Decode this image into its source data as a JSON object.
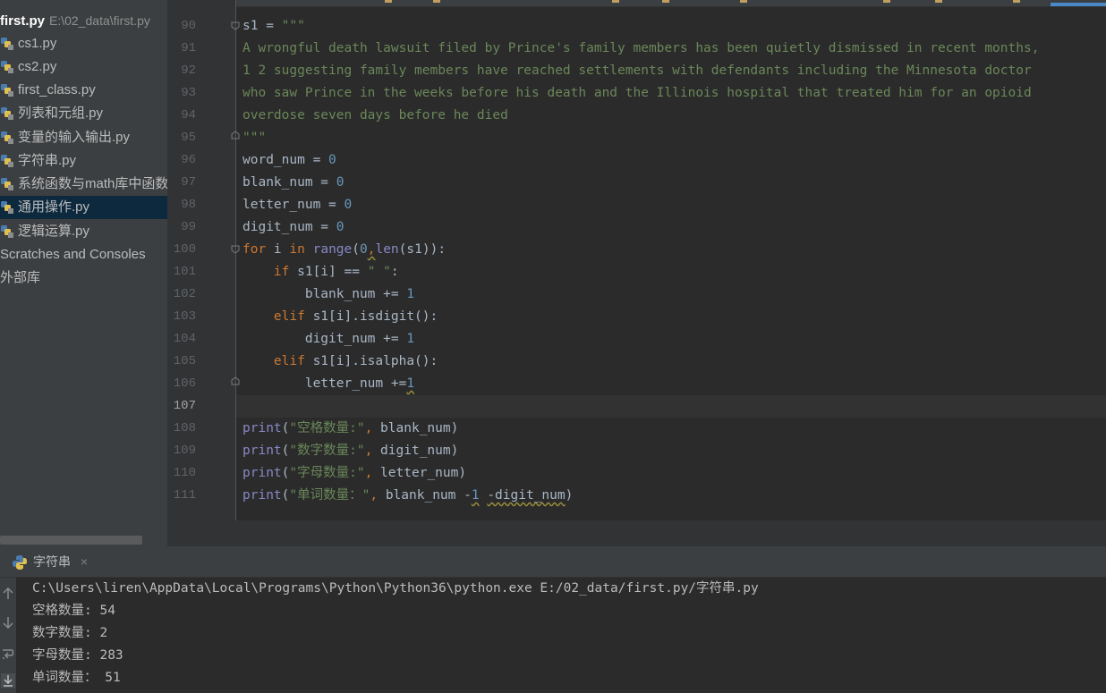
{
  "project": {
    "root_name": "first.py",
    "root_path": "E:\\02_data\\first.py",
    "files": [
      {
        "label": "cs1.py"
      },
      {
        "label": "cs2.py"
      },
      {
        "label": "first_class.py"
      },
      {
        "label": "列表和元组.py"
      },
      {
        "label": "变量的输入输出.py"
      },
      {
        "label": "字符串.py"
      },
      {
        "label": "系统函数与math库中函数"
      },
      {
        "label": "通用操作.py",
        "selected": true
      },
      {
        "label": "逻辑运算.py"
      }
    ],
    "scratches_label": "Scratches and Consoles",
    "external_libs_label": "外部库"
  },
  "editor": {
    "line_numbers": [
      "90",
      "91",
      "92",
      "93",
      "94",
      "95",
      "96",
      "97",
      "98",
      "99",
      "100",
      "101",
      "102",
      "103",
      "104",
      "105",
      "106",
      "107",
      "108",
      "109",
      "110",
      "111"
    ],
    "current_line": "107",
    "lines": [
      "s1 = \"\"\"",
      "A wrongful death lawsuit filed by Prince's family members has been quietly dismissed in recent months,",
      "1 2 suggesting family members have reached settlements with defendants including the Minnesota doctor",
      "who saw Prince in the weeks before his death and the Illinois hospital that treated him for an opioid",
      "overdose seven days before he died",
      "\"\"\"",
      "word_num = 0",
      "blank_num = 0",
      "letter_num = 0",
      "digit_num = 0",
      "for i in range(0,len(s1)):",
      "    if s1[i] == \" \":",
      "        blank_num += 1",
      "    elif s1[i].isdigit():",
      "        digit_num += 1",
      "    elif s1[i].isalpha():",
      "        letter_num +=1",
      "",
      "print(\"空格数量:\", blank_num)",
      "print(\"数字数量:\", digit_num)",
      "print(\"字母数量:\", letter_num)",
      "print(\"单词数量：\", blank_num -1 -digit_num)"
    ]
  },
  "run": {
    "tab_label": "字符串",
    "close_glyph": "×",
    "output": [
      "C:\\Users\\liren\\AppData\\Local\\Programs\\Python\\Python36\\python.exe E:/02_data/first.py/字符串.py",
      "空格数量: 54",
      "数字数量: 2",
      "字母数量: 283",
      "单词数量： 51"
    ]
  },
  "colors": {
    "keyword": "#cc7832",
    "number": "#6897bb",
    "string": "#6a8759",
    "builtin": "#8888c6",
    "selection": "#0d293e"
  },
  "icons": [
    "python-file-icon",
    "fold-marker-icon",
    "up-arrow-icon",
    "down-arrow-icon",
    "soft-wrap-icon",
    "scroll-to-end-icon",
    "close-icon"
  ]
}
